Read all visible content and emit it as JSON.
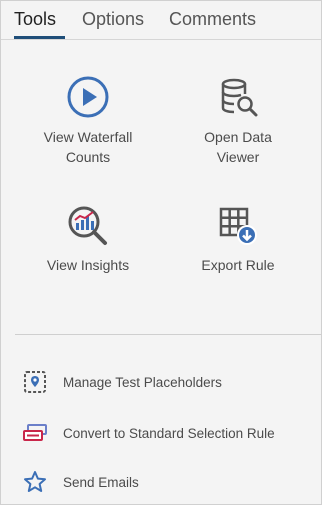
{
  "tabs": [
    {
      "label": "Tools",
      "active": true
    },
    {
      "label": "Options",
      "active": false
    },
    {
      "label": "Comments",
      "active": false
    }
  ],
  "tools": [
    {
      "label_line1": "View Waterfall",
      "label_line2": "Counts",
      "icon": "play-circle-icon"
    },
    {
      "label_line1": "Open Data",
      "label_line2": "Viewer",
      "icon": "database-search-icon"
    },
    {
      "label_line1": "View Insights",
      "label_line2": "",
      "icon": "insights-magnifier-icon"
    },
    {
      "label_line1": "Export Rule",
      "label_line2": "",
      "icon": "grid-download-icon"
    }
  ],
  "actions": [
    {
      "label": "Manage Test Placeholders",
      "icon": "location-placeholder-icon"
    },
    {
      "label": "Convert to Standard Selection Rule",
      "icon": "cards-convert-icon"
    },
    {
      "label": "Send Emails",
      "icon": "star-icon"
    }
  ],
  "colors": {
    "accent": "#3b6fb6",
    "icon_gray": "#555555",
    "action_red": "#c9264a",
    "tab_underline": "#1f4e79"
  }
}
